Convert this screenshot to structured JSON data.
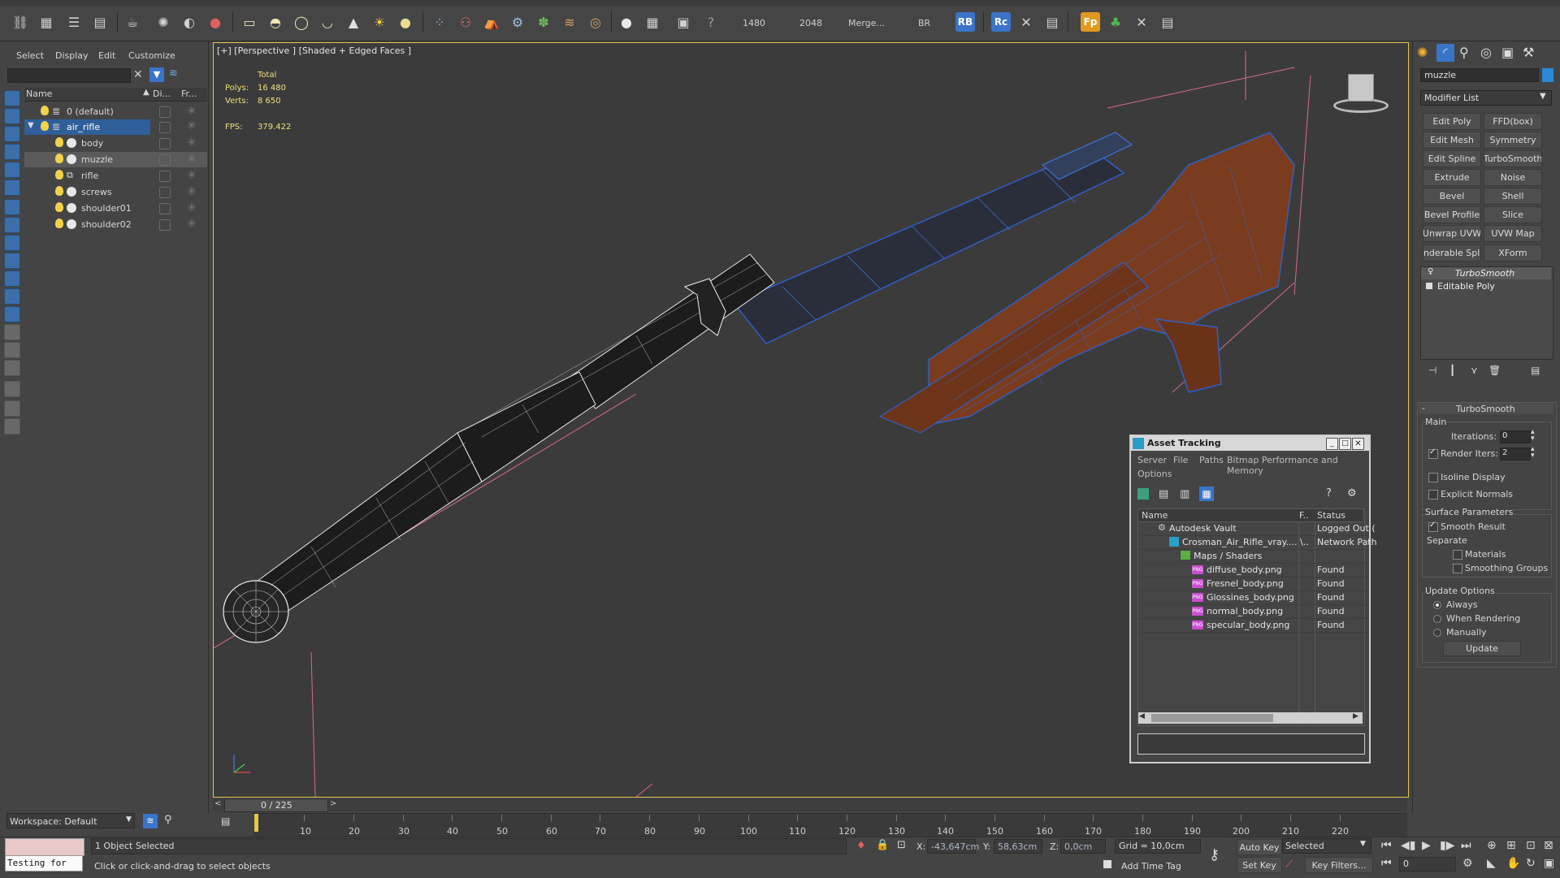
{
  "toolbar": {
    "render_width": "1480",
    "render_height": "2048",
    "merge_label": "Merge...",
    "br_label": "BR",
    "rb_badge": "RB",
    "rc_badge": "Rc",
    "fp_badge": "Fp"
  },
  "scene_explorer": {
    "menu": [
      "Select",
      "Display",
      "Edit",
      "Customize"
    ],
    "columns": {
      "name": "Name",
      "display": "Di...",
      "freeze": "Fr..."
    },
    "rows": [
      {
        "label": "0 (default)",
        "indent": 0
      },
      {
        "label": "air_rifle",
        "indent": 0
      },
      {
        "label": "body",
        "indent": 1
      },
      {
        "label": "muzzle",
        "indent": 1
      },
      {
        "label": "rifle",
        "indent": 1
      },
      {
        "label": "screws",
        "indent": 1
      },
      {
        "label": "shoulder01",
        "indent": 1
      },
      {
        "label": "shoulder02",
        "indent": 1
      }
    ],
    "workspace": "Workspace: Default"
  },
  "viewport": {
    "label": "[+] [Perspective ] [Shaded + Edged Faces ]",
    "stats": {
      "total": "Total",
      "polys_label": "Polys:",
      "polys": "16 480",
      "verts_label": "Verts:",
      "verts": "8 650",
      "fps_label": "FPS:",
      "fps": "379.422"
    }
  },
  "command_panel": {
    "object_name": "muzzle",
    "modifier_list": "Modifier List",
    "modifier_buttons": [
      [
        "Edit Poly",
        "FFD(box)"
      ],
      [
        "Edit Mesh",
        "Symmetry"
      ],
      [
        "Edit Spline",
        "TurboSmooth"
      ],
      [
        "Extrude",
        "Noise"
      ],
      [
        "Bevel",
        "Shell"
      ],
      [
        "Bevel Profile",
        "Slice"
      ],
      [
        "Unwrap UVW",
        "UVW Map"
      ],
      [
        "enderable Splir",
        "XForm"
      ]
    ],
    "stack": [
      "TurboSmooth",
      "Editable Poly"
    ],
    "turbosmooth": {
      "title": "TurboSmooth",
      "main": "Main",
      "iterations_label": "Iterations:",
      "iterations": "0",
      "render_iters_label": "Render Iters:",
      "render_iters": "2",
      "isoline": "Isoline Display",
      "explicit_normals": "Explicit Normals",
      "surface_params": "Surface Parameters",
      "smooth_result": "Smooth Result",
      "separate": "Separate",
      "materials": "Materials",
      "smoothing_groups": "Smoothing Groups",
      "update_options": "Update Options",
      "always": "Always",
      "when_rendering": "When Rendering",
      "manually": "Manually",
      "update_button": "Update"
    }
  },
  "asset_tracking": {
    "title": "Asset Tracking",
    "menu": [
      "Server",
      "File",
      "Paths",
      "Bitmap Performance and Memory",
      "Options"
    ],
    "columns": {
      "name": "Name",
      "full": "F..",
      "status": "Status"
    },
    "rows": [
      {
        "name": "Autodesk Vault",
        "full": "",
        "status": "Logged Out (",
        "icon": "vault"
      },
      {
        "name": "Crosman_Air_Rifle_vray....",
        "full": "\\..",
        "status": "Network Path",
        "icon": "max"
      },
      {
        "name": "Maps / Shaders",
        "full": "",
        "status": "",
        "icon": "maps"
      },
      {
        "name": "diffuse_body.png",
        "full": "",
        "status": "Found",
        "icon": "png"
      },
      {
        "name": "Fresnel_body.png",
        "full": "",
        "status": "Found",
        "icon": "png"
      },
      {
        "name": "Glossines_body.png",
        "full": "",
        "status": "Found",
        "icon": "png"
      },
      {
        "name": "normal_body.png",
        "full": "",
        "status": "Found",
        "icon": "png"
      },
      {
        "name": "specular_body.png",
        "full": "",
        "status": "Found",
        "icon": "png"
      }
    ]
  },
  "timeline": {
    "frame_counter": "0 / 225",
    "ticks": [
      "10",
      "20",
      "30",
      "40",
      "50",
      "60",
      "70",
      "80",
      "90",
      "100",
      "110",
      "120",
      "130",
      "140",
      "150",
      "160",
      "170",
      "180",
      "190",
      "200",
      "210",
      "220"
    ]
  },
  "status_bar": {
    "maxscript": "Testing for",
    "selection": "1 Object Selected",
    "prompt": "Click or click-and-drag to select objects",
    "x_label": "X:",
    "x": "-43,647cm",
    "y_label": "Y:",
    "y": "58,63cm",
    "z_label": "Z:",
    "z": "0,0cm",
    "grid": "Grid = 10,0cm",
    "add_time_tag": "Add Time Tag",
    "auto_key": "Auto Key",
    "set_key": "Set Key",
    "selected": "Selected",
    "key_filters": "Key Filters...",
    "frame": "0"
  }
}
